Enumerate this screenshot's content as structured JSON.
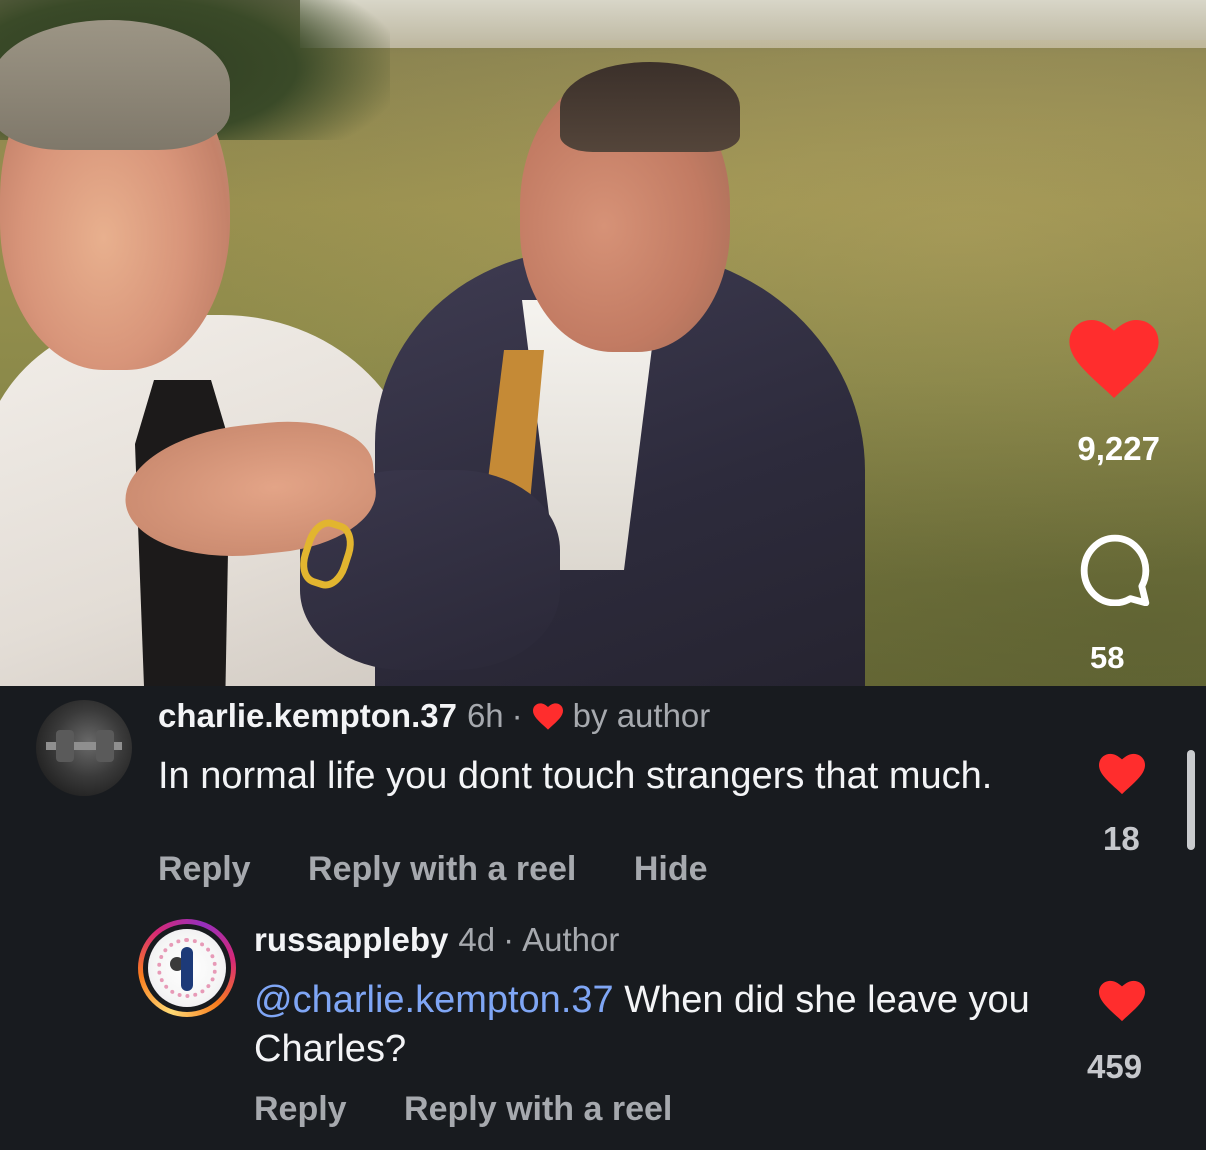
{
  "video": {
    "like_count": "9,227",
    "comment_count": "58",
    "like_color": "#ff2d2d"
  },
  "comments": [
    {
      "username": "charlie.kempton.37",
      "time": "6h",
      "separator": "·",
      "badge": "by author",
      "text": "In normal life you dont touch strangers that much.",
      "actions": [
        "Reply",
        "Reply with a reel",
        "Hide"
      ],
      "like_count": "18"
    },
    {
      "username": "russappleby",
      "time": "4d",
      "separator": "·",
      "badge": "Author",
      "mention": "@charlie.kempton.37",
      "text": " When did she leave you Charles?",
      "actions": [
        "Reply",
        "Reply with a reel"
      ],
      "like_count": "459"
    }
  ],
  "icons": {
    "video_like": "heart-icon",
    "video_comment": "comment-bubble-icon",
    "liked_by_author": "heart-icon",
    "comment_like": "heart-icon"
  },
  "colors": {
    "background": "#181b1f",
    "heart": "#ff2d2d",
    "mention": "#7fa6f5",
    "muted_text": "#a6a9ae"
  }
}
